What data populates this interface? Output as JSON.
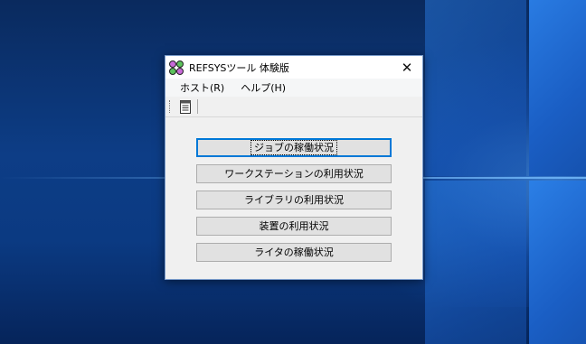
{
  "window": {
    "title": "REFSYSツール 体験版",
    "close_glyph": "✕"
  },
  "menu": {
    "items": [
      "ホスト(R)",
      "ヘルプ(H)"
    ]
  },
  "toolbar": {
    "icons": [
      "document-icon"
    ]
  },
  "buttons": [
    {
      "label": "ジョブの稼働状況",
      "focused": true
    },
    {
      "label": "ワークステーションの利用状況",
      "focused": false
    },
    {
      "label": "ライブラリの利用状況",
      "focused": false
    },
    {
      "label": "装置の利用状況",
      "focused": false
    },
    {
      "label": "ライタの稼働状況",
      "focused": false
    }
  ],
  "colors": {
    "desktop": "#0b3a82",
    "window_bg": "#f0f0f0",
    "focus_accent": "#0078d7"
  }
}
